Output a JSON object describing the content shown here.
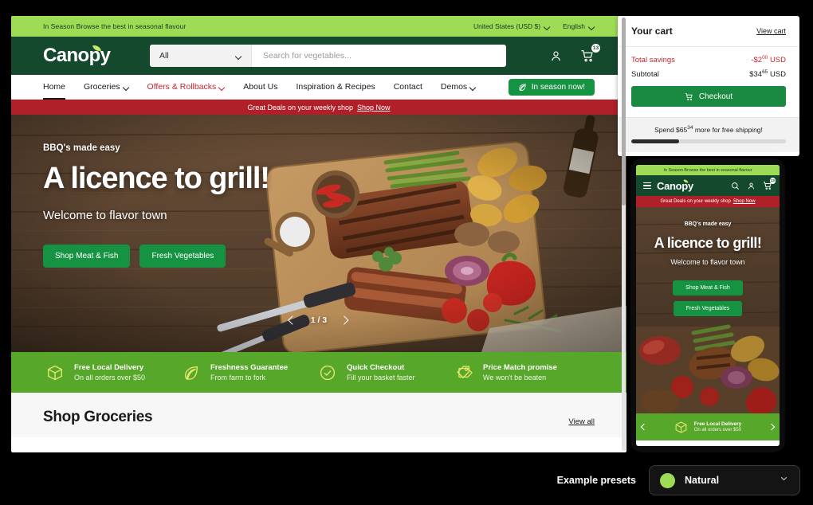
{
  "desktop": {
    "announcement": {
      "message": "In Season Browse the best in seasonal flavour",
      "country": "United States (USD $)",
      "language": "English"
    },
    "header": {
      "logo": "Canopy",
      "search_category": "All",
      "search_placeholder": "Search for vegetables...",
      "account_icon": "user-icon",
      "cart_icon": "cart-icon",
      "cart_count": "13"
    },
    "nav": {
      "items": [
        {
          "label": "Home",
          "has_caret": false,
          "active": true,
          "sale": false
        },
        {
          "label": "Groceries",
          "has_caret": true,
          "active": false,
          "sale": false
        },
        {
          "label": "Offers & Rollbacks",
          "has_caret": true,
          "active": false,
          "sale": true
        },
        {
          "label": "About Us",
          "has_caret": false,
          "active": false,
          "sale": false
        },
        {
          "label": "Inspiration & Recipes",
          "has_caret": false,
          "active": false,
          "sale": false
        },
        {
          "label": "Contact",
          "has_caret": false,
          "active": false,
          "sale": false
        },
        {
          "label": "Demos",
          "has_caret": true,
          "active": false,
          "sale": false
        }
      ],
      "cta": "In season now!",
      "cta_icon": "leaf-icon"
    },
    "deal_strip": {
      "text": "Great Deals on your weekly shop",
      "link": "Shop Now"
    },
    "hero": {
      "eyebrow": "BBQ's made easy",
      "title": "A licence to grill!",
      "subtitle": "Welcome to flavor town",
      "button_primary": "Shop Meat & Fish",
      "button_secondary": "Fresh Vegetables",
      "slide_counter": "1 / 3",
      "prev_icon": "chevron-left-icon",
      "next_icon": "chevron-right-icon"
    },
    "benefits": [
      {
        "icon": "box-icon",
        "title": "Free Local Delivery",
        "subtitle": "On all orders over $50"
      },
      {
        "icon": "leaf-icon",
        "title": "Freshness Guarantee",
        "subtitle": "From farm to fork"
      },
      {
        "icon": "check-circle-icon",
        "title": "Quick Checkout",
        "subtitle": "Fill your basket faster"
      },
      {
        "icon": "tag-icon",
        "title": "Price Match promise",
        "subtitle": "We won't be beaten"
      }
    ],
    "shop_section": {
      "title": "Shop Groceries",
      "view_all": "View all"
    }
  },
  "cart": {
    "title": "Your cart",
    "view_cart": "View cart",
    "savings_label": "Total savings",
    "savings_value": "-$2",
    "savings_sup": "00",
    "savings_currency": "USD",
    "subtotal_label": "Subtotal",
    "subtotal_value": "$34",
    "subtotal_sup": "65",
    "subtotal_currency": "USD",
    "checkout_label": "Checkout",
    "checkout_icon": "cart-icon",
    "free_shipping_prefix": "Spend $65",
    "free_shipping_sup": "34",
    "free_shipping_suffix": "more for free shipping!",
    "progress_percent": 31
  },
  "mobile": {
    "announcement": "In Season Browse the best in seasonal flavour",
    "logo": "Canopy",
    "menu_icon": "hamburger-icon",
    "search_icon": "search-icon",
    "account_icon": "user-icon",
    "cart_icon": "cart-icon",
    "cart_count": "13",
    "deal_text": "Great Deals on your weekly shop",
    "deal_link": "Shop Now",
    "hero": {
      "eyebrow": "BBQ's made easy",
      "title": "A licence to grill!",
      "subtitle": "Welcome to flavor town",
      "button_primary": "Shop Meat & Fish",
      "button_secondary": "Fresh Vegetables"
    },
    "benefit": {
      "icon": "box-icon",
      "title": "Free Local Delivery",
      "subtitle": "On all orders over $50"
    }
  },
  "presets": {
    "label": "Example presets",
    "selected": "Natural",
    "swatch_color": "#9fdc55",
    "chevron_icon": "chevron-down-icon"
  },
  "colors": {
    "brand_dark_green": "#14492e",
    "brand_light_green": "#9fdc55",
    "accent_green": "#159242",
    "sale_red": "#c1272d",
    "deal_red": "#b02028",
    "benefit_green": "#57a72b"
  }
}
